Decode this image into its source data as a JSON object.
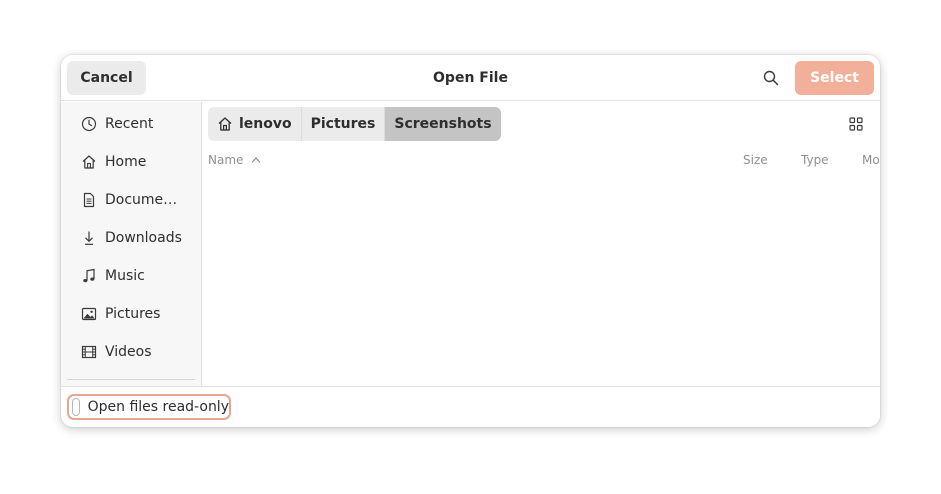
{
  "dialog": {
    "title": "Open File",
    "cancel_label": "Cancel",
    "select_label": "Select",
    "accent_color": "#f2b09a"
  },
  "sidebar": {
    "items": [
      {
        "label": "Recent",
        "icon": "clock-icon"
      },
      {
        "label": "Home",
        "icon": "home-icon"
      },
      {
        "label": "Docume…",
        "icon": "document-icon"
      },
      {
        "label": "Downloads",
        "icon": "download-icon"
      },
      {
        "label": "Music",
        "icon": "music-icon"
      },
      {
        "label": "Pictures",
        "icon": "image-icon"
      },
      {
        "label": "Videos",
        "icon": "film-icon"
      }
    ]
  },
  "pathbar": {
    "crumbs": [
      {
        "label": "lenovo",
        "icon": "home-icon"
      },
      {
        "label": "Pictures"
      },
      {
        "label": "Screenshots",
        "active": true
      }
    ]
  },
  "columns": {
    "name": "Name",
    "size": "Size",
    "type": "Type",
    "modified": "Modified"
  },
  "footer": {
    "readonly_label": "Open files read-only",
    "readonly_checked": false
  }
}
